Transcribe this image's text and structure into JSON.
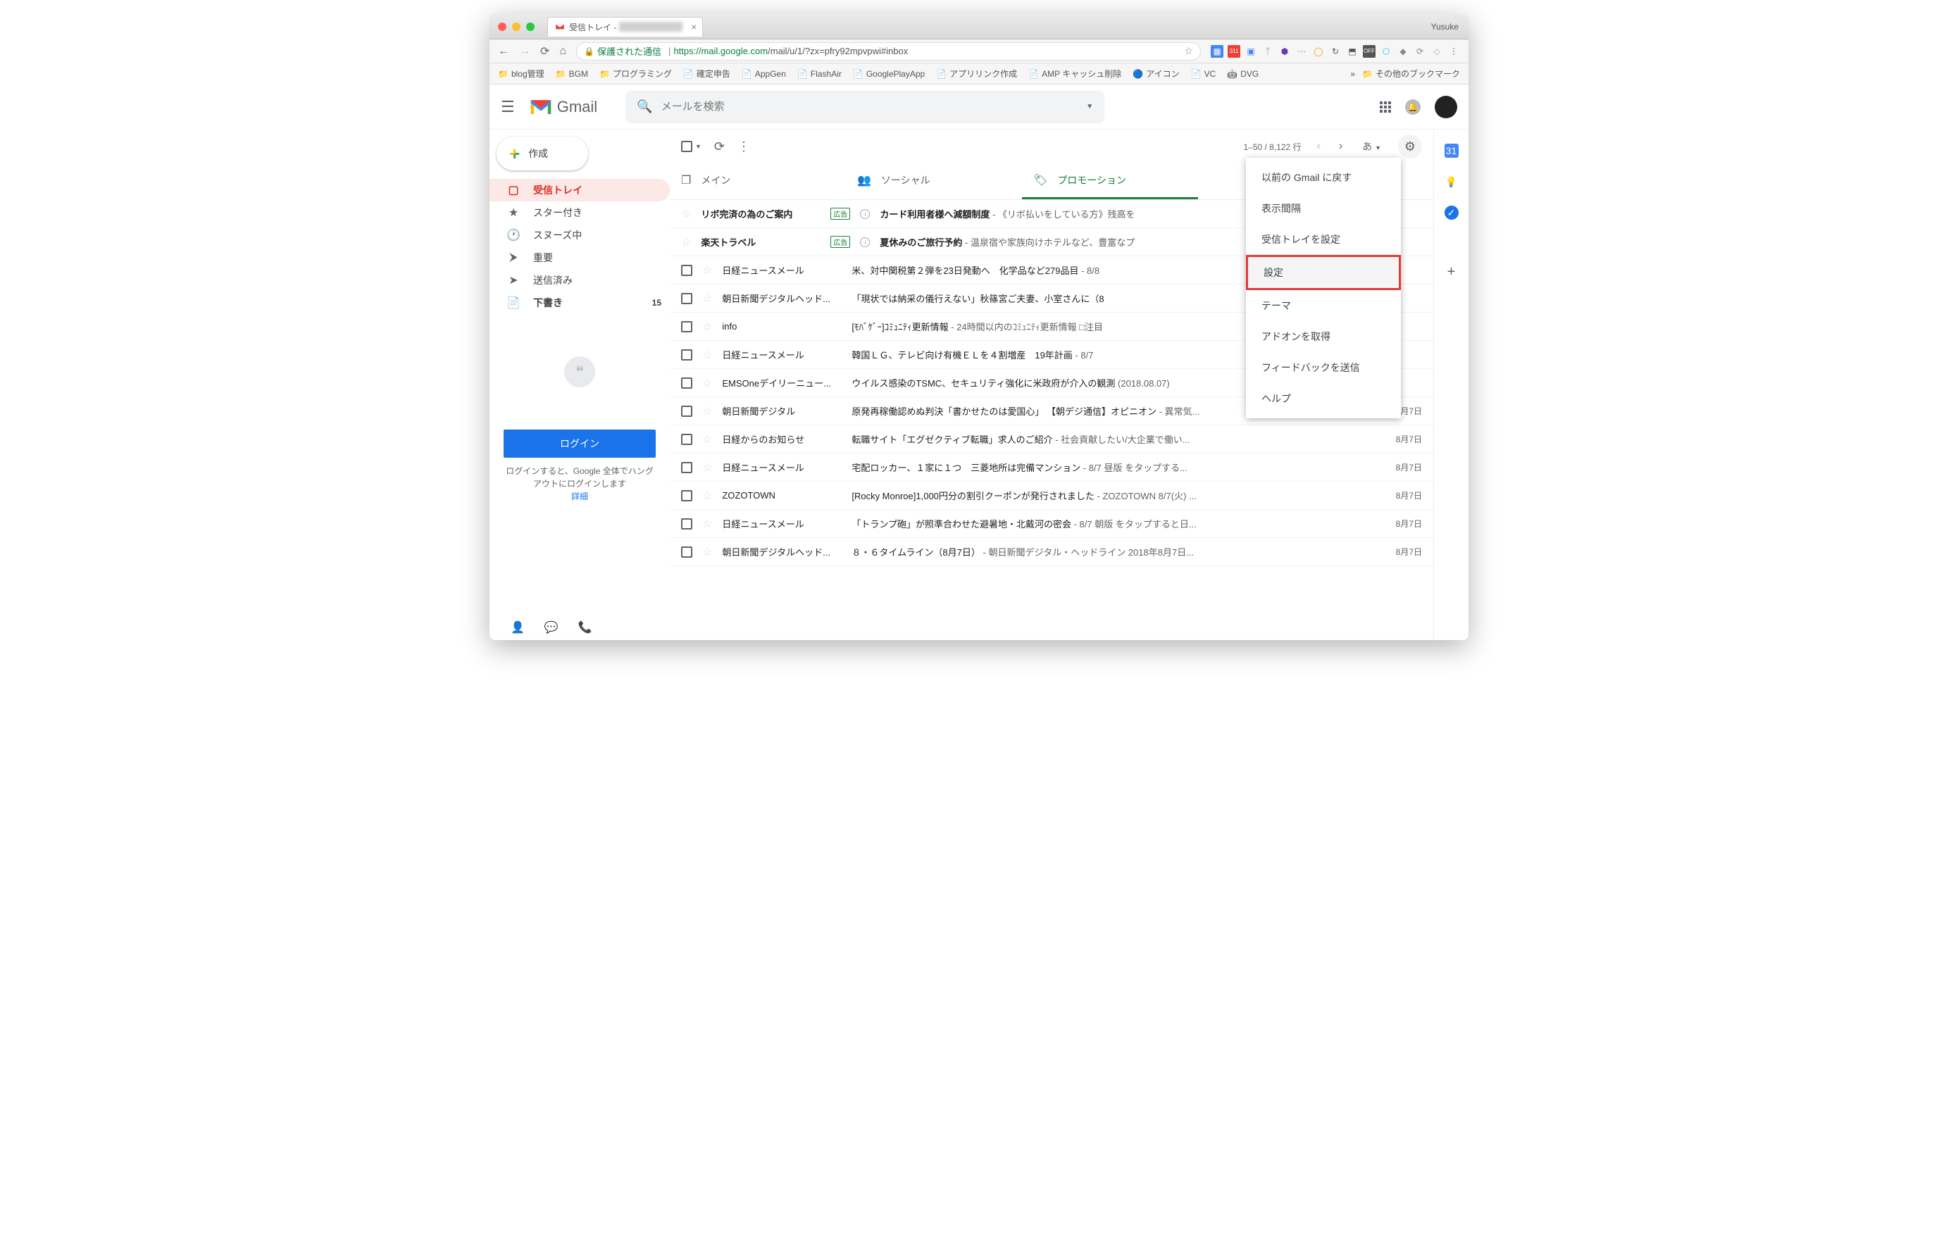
{
  "titlebar": {
    "tab_title": "受信トレイ - ",
    "user": "Yusuke"
  },
  "urlbar": {
    "secure_label": "保護された通信",
    "url_host": "https://mail.google.com",
    "url_path": "/mail/u/1/?zx=pfry92mpvpwi#inbox"
  },
  "bookmarks": {
    "items": [
      {
        "label": "blog管理",
        "type": "folder"
      },
      {
        "label": "BGM",
        "type": "folder"
      },
      {
        "label": "プログラミング",
        "type": "folder"
      },
      {
        "label": "確定申告",
        "type": "doc"
      },
      {
        "label": "AppGen",
        "type": "doc"
      },
      {
        "label": "FlashAir",
        "type": "doc"
      },
      {
        "label": "GooglePlayApp",
        "type": "doc"
      },
      {
        "label": "アプリリンク作成",
        "type": "doc"
      },
      {
        "label": "AMP キャッシュ削除",
        "type": "doc"
      },
      {
        "label": "アイコン",
        "type": "icon"
      },
      {
        "label": "VC",
        "type": "doc"
      },
      {
        "label": "DVG",
        "type": "android"
      }
    ],
    "other": "その他のブックマーク"
  },
  "header": {
    "brand": "Gmail",
    "search_placeholder": "メールを検索"
  },
  "compose": {
    "label": "作成"
  },
  "sidebar": {
    "items": [
      {
        "icon": "inbox",
        "label": "受信トレイ",
        "active": true
      },
      {
        "icon": "star",
        "label": "スター付き"
      },
      {
        "icon": "clock",
        "label": "スヌーズ中"
      },
      {
        "icon": "important",
        "label": "重要"
      },
      {
        "icon": "sent",
        "label": "送信済み"
      },
      {
        "icon": "draft",
        "label": "下書き",
        "count": "15",
        "bold": true
      }
    ],
    "login_button": "ログイン",
    "login_text": "ログインすると、Google 全体でハングアウトにログインします",
    "login_link": "詳細"
  },
  "toolbar": {
    "page_info": "1–50 / 8,122 行",
    "lang": "あ"
  },
  "tabs": [
    {
      "icon": "❐",
      "label": "メイン"
    },
    {
      "icon": "👥",
      "label": "ソーシャル"
    },
    {
      "icon": "🏷",
      "label": "プロモーション",
      "active": true
    }
  ],
  "settings_menu": [
    {
      "label": "以前の Gmail に戻す"
    },
    {
      "label": "表示間隔"
    },
    {
      "label": "受信トレイを設定"
    },
    {
      "label": "設定",
      "highlighted": true
    },
    {
      "label": "テーマ"
    },
    {
      "label": "アドオンを取得"
    },
    {
      "label": "フィードバックを送信"
    },
    {
      "label": "ヘルプ"
    }
  ],
  "ad_label": "広告",
  "mails": [
    {
      "ad": true,
      "sender": "リボ完済の為のご案内",
      "subject": "カード利用者様へ減額制度",
      "snippet": " - 《リボ払いをしている方》残高を",
      "unread": true
    },
    {
      "ad": true,
      "sender": "楽天トラベル",
      "subject": "夏休みのご旅行予約",
      "snippet": " - 温泉宿や家族向けホテルなど、豊富なプ",
      "unread": true
    },
    {
      "sender": "日経ニュースメール",
      "subject": "米、対中関税第２弾を23日発動へ　化学品など279品目",
      "snippet": " - 8/8",
      "date": ""
    },
    {
      "sender": "朝日新聞デジタルヘッド...",
      "subject": "「現状では納采の儀行えない」秋篠宮ご夫妻、小室さんに（8",
      "snippet": "",
      "date": ""
    },
    {
      "sender": "info",
      "subject": "[ﾓﾊﾞｹﾞｰ]ｺﾐｭﾆﾃｨ更新情報",
      "snippet": " - 24時間以内のｺﾐｭﾆﾃｨ更新情報 □注目",
      "date": ""
    },
    {
      "sender": "日経ニュースメール",
      "subject": "韓国ＬＧ、テレビ向け有機ＥＬを４割増産　19年計画",
      "snippet": " - 8/7",
      "date": ""
    },
    {
      "sender": "EMSOneデイリーニュー...",
      "subject": "ウイルス感染のTSMC、セキュリティ強化に米政府が介入の観測",
      "snippet": " (2018.08.07)",
      "date": ""
    },
    {
      "sender": "朝日新聞デジタル",
      "subject": "原発再稼働認めぬ判決「書かせたのは愛国心」 【朝デジ通信】オピニオン",
      "snippet": " - 異常気...",
      "date": "8月7日"
    },
    {
      "sender": "日経からのお知らせ",
      "subject": "転職サイト「エグゼクティブ転職」求人のご紹介",
      "snippet": " - 社会貢献したい/大企業で働い...",
      "date": "8月7日"
    },
    {
      "sender": "日経ニュースメール",
      "subject": "宅配ロッカー、１家に１つ　三菱地所は完備マンション",
      "snippet": " - 8/7 昼版 をタップする...",
      "date": "8月7日"
    },
    {
      "sender": "ZOZOTOWN",
      "subject": "[Rocky Monroe]1,000円分の割引クーポンが発行されました",
      "snippet": " - ZOZOTOWN 8/7(火) ...",
      "date": "8月7日"
    },
    {
      "sender": "日経ニュースメール",
      "subject": "「トランプ砲」が照準合わせた避暑地・北戴河の密会",
      "snippet": " - 8/7 朝版 をタップすると日...",
      "date": "8月7日"
    },
    {
      "sender": "朝日新聞デジタルヘッド...",
      "subject": "８・６タイムライン（8月7日）",
      "snippet": " - 朝日新聞デジタル・ヘッドライン 2018年8月7日...",
      "date": "8月7日"
    }
  ]
}
